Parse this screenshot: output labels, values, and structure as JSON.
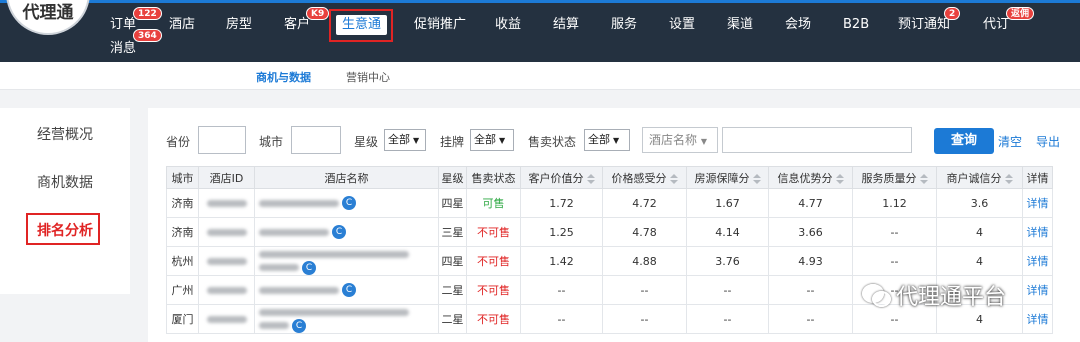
{
  "logo": {
    "text": "代理通"
  },
  "nav": {
    "items": [
      "订单",
      "酒店",
      "房型",
      "客户",
      "生意通",
      "促销推广",
      "收益",
      "结算",
      "服务",
      "设置",
      "渠道",
      "会场",
      "B2B",
      "预订通知",
      "代订",
      "消息"
    ],
    "badges": {
      "orders": "122",
      "customers": "K9",
      "booking_notice": "2",
      "proxy_booking": "返佣",
      "messages": "364"
    },
    "active": "生意通"
  },
  "subnav": {
    "tabs": [
      "商机与数据",
      "营销中心"
    ]
  },
  "sidebar": {
    "items": [
      "经营概况",
      "商机数据",
      "排名分析"
    ],
    "current": "排名分析"
  },
  "filters": {
    "province_label": "省份",
    "city_label": "城市",
    "star_label": "星级",
    "star_value": "全部",
    "brand_label": "挂牌",
    "brand_value": "全部",
    "sale_label": "售卖状态",
    "sale_value": "全部",
    "hotel_select": "酒店名称",
    "query_button": "查询",
    "clear_link": "清空",
    "export_link": "导出"
  },
  "table": {
    "headers": [
      "城市",
      "酒店ID",
      "酒店名称",
      "星级",
      "售卖状态",
      "客户价值分",
      "价格感受分",
      "房源保障分",
      "信息优势分",
      "服务质量分",
      "商户诚信分",
      "详情"
    ],
    "rows": [
      {
        "city": "济南",
        "star": "四星",
        "status": "可售",
        "value": "1.72",
        "price": "4.72",
        "supply": "1.67",
        "info": "4.77",
        "service": "1.12",
        "integrity": "3.6",
        "detail": "详情"
      },
      {
        "city": "济南",
        "star": "三星",
        "status": "不可售",
        "value": "1.25",
        "price": "4.78",
        "supply": "4.14",
        "info": "3.66",
        "service": "--",
        "integrity": "4",
        "detail": "详情"
      },
      {
        "city": "杭州",
        "star": "四星",
        "status": "不可售",
        "value": "1.42",
        "price": "4.88",
        "supply": "3.76",
        "info": "4.93",
        "service": "--",
        "integrity": "4",
        "detail": "详情"
      },
      {
        "city": "广州",
        "star": "二星",
        "status": "不可售",
        "value": "--",
        "price": "--",
        "supply": "--",
        "info": "--",
        "service": "--",
        "integrity": "",
        "detail": "详情"
      },
      {
        "city": "厦门",
        "star": "二星",
        "status": "不可售",
        "value": "--",
        "price": "--",
        "supply": "--",
        "info": "--",
        "service": "--",
        "integrity": "4",
        "detail": "详情"
      }
    ]
  },
  "watermark": {
    "text": "代理通平台"
  },
  "colors": {
    "nav_bg": "#243140",
    "accent": "#1c7ad6",
    "highlight": "#e02424",
    "available": "#2ea843"
  }
}
